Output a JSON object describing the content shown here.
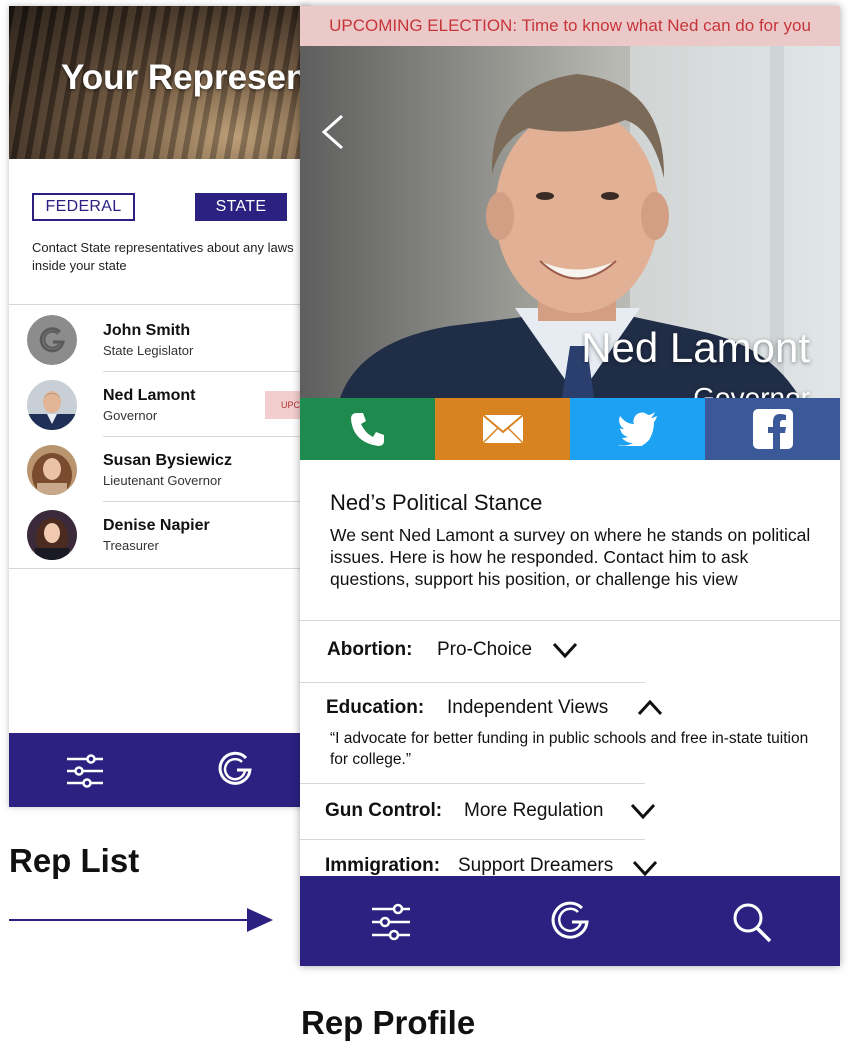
{
  "rep_list": {
    "hero_title": "Your Representatives",
    "tabs": {
      "federal": "FEDERAL",
      "state": "STATE"
    },
    "description": [
      "Contact State representatives about any laws",
      "inside your state"
    ],
    "reps": [
      {
        "name": "John Smith",
        "title": "State Legislator",
        "avatar": "g-logo"
      },
      {
        "name": "Ned Lamont",
        "title": "Governor",
        "avatar": "photo",
        "badge": "UPC"
      },
      {
        "name": "Susan Bysiewicz",
        "title": "Lieutenant Governor",
        "avatar": "photo"
      },
      {
        "name": "Denise Napier",
        "title": "Treasurer",
        "avatar": "photo"
      }
    ],
    "nav_icons": [
      "filter-icon",
      "g-logo-icon"
    ]
  },
  "rep_profile": {
    "banner": "UPCOMING ELECTION: Time to know what Ned can do for you",
    "name": "Ned Lamont",
    "role": "Governor",
    "contact": [
      {
        "icon": "phone-icon",
        "color": "#1e8a4e"
      },
      {
        "icon": "mail-icon",
        "color": "#d98320"
      },
      {
        "icon": "twitter-icon",
        "color": "#1da1f2"
      },
      {
        "icon": "facebook-icon",
        "color": "#3b5998"
      }
    ],
    "stance_title": "Ned’s Political Stance",
    "stance_desc": "We sent Ned Lamont a survey on where he stands on political issues. Here is how he responded. Contact him to ask questions, support his position, or challenge his view",
    "issues": [
      {
        "label": "Abortion:",
        "value": "Pro-Choice",
        "expanded": false
      },
      {
        "label": "Education:",
        "value": "Independent Views",
        "expanded": true,
        "detail": "“I advocate for better funding in public schools and free in-state tuition for college.”"
      },
      {
        "label": "Gun Control:",
        "value": "More Regulation",
        "expanded": false
      },
      {
        "label": "Immigration:",
        "value": "Support Dreamers",
        "expanded": false
      }
    ],
    "nav_icons": [
      "filter-icon",
      "g-logo-icon",
      "search-icon"
    ]
  },
  "captions": {
    "list": "Rep List",
    "profile": "Rep Profile"
  },
  "colors": {
    "brand": "#2c2180",
    "banner_bg": "#ecc9c9",
    "banner_text": "#c6353a"
  }
}
